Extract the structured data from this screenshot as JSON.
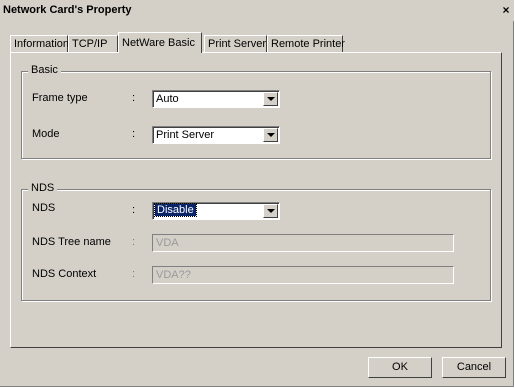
{
  "window": {
    "title": "Network Card's Property",
    "close_label": "×"
  },
  "tabs": [
    {
      "label": "Information"
    },
    {
      "label": "TCP/IP"
    },
    {
      "label": "NetWare Basic"
    },
    {
      "label": "Print Server"
    },
    {
      "label": "Remote Printer"
    }
  ],
  "active_tab": "NetWare Basic",
  "basic": {
    "legend": "Basic",
    "frame_type": {
      "label": "Frame type",
      "colon": ":",
      "value": "Auto"
    },
    "mode": {
      "label": "Mode",
      "colon": ":",
      "value": "Print Server"
    }
  },
  "nds": {
    "legend": "NDS",
    "nds": {
      "label": "NDS",
      "colon": ":",
      "value": "Disable"
    },
    "tree_name": {
      "label": "NDS Tree name",
      "colon": ":",
      "value": "VDA"
    },
    "context": {
      "label": "NDS Context",
      "colon": ":",
      "value": "VDA??"
    }
  },
  "buttons": {
    "ok": "OK",
    "cancel": "Cancel"
  }
}
